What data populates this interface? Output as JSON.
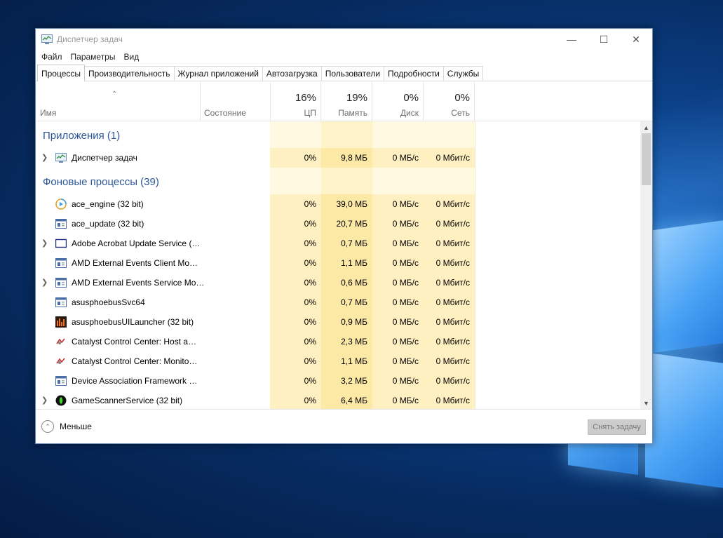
{
  "window": {
    "title": "Диспетчер задач",
    "controls": {
      "minimize": "—",
      "maximize": "☐",
      "close": "✕"
    }
  },
  "menu": [
    "Файл",
    "Параметры",
    "Вид"
  ],
  "tabs": [
    {
      "label": "Процессы",
      "active": true
    },
    {
      "label": "Производительность"
    },
    {
      "label": "Журнал приложений"
    },
    {
      "label": "Автозагрузка"
    },
    {
      "label": "Пользователи"
    },
    {
      "label": "Подробности"
    },
    {
      "label": "Службы"
    }
  ],
  "columns": {
    "name": "Имя",
    "status": "Состояние",
    "cpu": {
      "percent": "16%",
      "label": "ЦП"
    },
    "memory": {
      "percent": "19%",
      "label": "Память"
    },
    "disk": {
      "percent": "0%",
      "label": "Диск"
    },
    "network": {
      "percent": "0%",
      "label": "Сеть"
    }
  },
  "groups": {
    "apps": "Приложения (1)",
    "background": "Фоновые процессы (39)"
  },
  "apps": [
    {
      "name": "Диспетчер задач",
      "icon": "task-manager-icon",
      "expandable": true,
      "cpu": "0%",
      "mem": "9,8 МБ",
      "disk": "0 МБ/с",
      "net": "0 Мбит/с"
    }
  ],
  "background": [
    {
      "name": "ace_engine (32 bit)",
      "icon": "ace-engine-icon",
      "expandable": false,
      "cpu": "0%",
      "mem": "39,0 МБ",
      "disk": "0 МБ/с",
      "net": "0 Мбит/с"
    },
    {
      "name": "ace_update (32 bit)",
      "icon": "generic-app-icon",
      "expandable": false,
      "cpu": "0%",
      "mem": "20,7 МБ",
      "disk": "0 МБ/с",
      "net": "0 Мбит/с"
    },
    {
      "name": "Adobe Acrobat Update Service (…",
      "icon": "service-window-icon",
      "expandable": true,
      "cpu": "0%",
      "mem": "0,7 МБ",
      "disk": "0 МБ/с",
      "net": "0 Мбит/с"
    },
    {
      "name": "AMD External Events Client Mo…",
      "icon": "generic-app-icon",
      "expandable": false,
      "cpu": "0%",
      "mem": "1,1 МБ",
      "disk": "0 МБ/с",
      "net": "0 Мбит/с"
    },
    {
      "name": "AMD External Events Service Mo…",
      "icon": "generic-app-icon",
      "expandable": true,
      "cpu": "0%",
      "mem": "0,6 МБ",
      "disk": "0 МБ/с",
      "net": "0 Мбит/с"
    },
    {
      "name": "asusphoebusSvc64",
      "icon": "generic-app-icon",
      "expandable": false,
      "cpu": "0%",
      "mem": "0,7 МБ",
      "disk": "0 МБ/с",
      "net": "0 Мбит/с"
    },
    {
      "name": "asusphoebusUILauncher (32 bit)",
      "icon": "equalizer-icon",
      "expandable": false,
      "cpu": "0%",
      "mem": "0,9 МБ",
      "disk": "0 МБ/с",
      "net": "0 Мбит/с"
    },
    {
      "name": "Catalyst Control Center: Host a…",
      "icon": "catalyst-icon",
      "expandable": false,
      "cpu": "0%",
      "mem": "2,3 МБ",
      "disk": "0 МБ/с",
      "net": "0 Мбит/с"
    },
    {
      "name": "Catalyst Control Center: Monito…",
      "icon": "catalyst-icon",
      "expandable": false,
      "cpu": "0%",
      "mem": "1,1 МБ",
      "disk": "0 МБ/с",
      "net": "0 Мбит/с"
    },
    {
      "name": "Device Association Framework …",
      "icon": "generic-app-icon",
      "expandable": false,
      "cpu": "0%",
      "mem": "3,2 МБ",
      "disk": "0 МБ/с",
      "net": "0 Мбит/с"
    },
    {
      "name": "GameScannerService (32 bit)",
      "icon": "razer-icon",
      "expandable": true,
      "cpu": "0%",
      "mem": "6,4 МБ",
      "disk": "0 МБ/с",
      "net": "0 Мбит/с"
    }
  ],
  "footer": {
    "less_label": "Меньше",
    "end_task_label": "Снять задачу"
  },
  "colors": {
    "group_heading": "#2b5797",
    "memory_highlight": "#fde9a6",
    "column_tint": "#fff9e1"
  }
}
